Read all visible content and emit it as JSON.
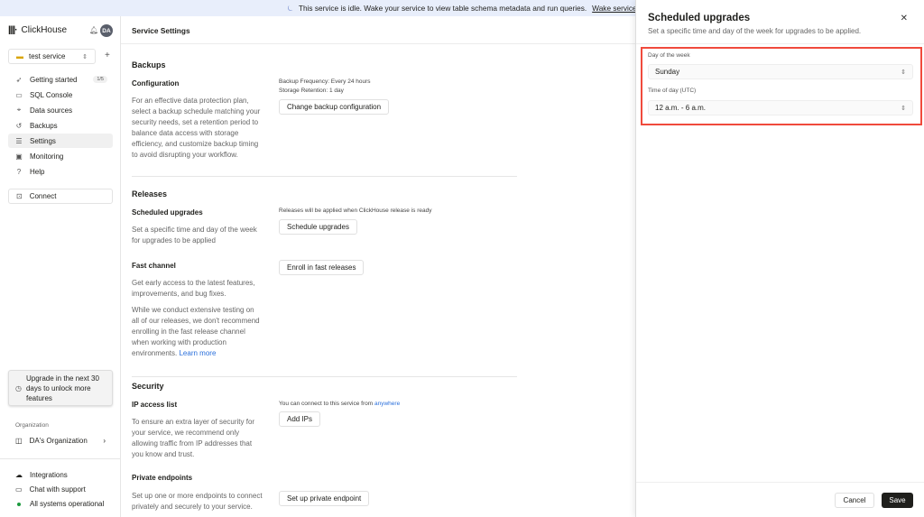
{
  "banner": {
    "text": "This service is idle. Wake your service to view table schema metadata and run queries.",
    "link": "Wake service"
  },
  "sidebar": {
    "brand": "ClickHouse",
    "avatar": "DA",
    "service": "test service",
    "items": [
      {
        "label": "Getting started",
        "icon": "rocket-icon",
        "badge": "1/5"
      },
      {
        "label": "SQL Console",
        "icon": "console-icon"
      },
      {
        "label": "Data sources",
        "icon": "data-sources-icon"
      },
      {
        "label": "Backups",
        "icon": "backup-icon"
      },
      {
        "label": "Settings",
        "icon": "settings-icon",
        "active": true
      },
      {
        "label": "Monitoring",
        "icon": "monitoring-icon"
      },
      {
        "label": "Help",
        "icon": "help-icon"
      }
    ],
    "connect": "Connect",
    "upgrade": "Upgrade in the next 30 days to unlock more features",
    "org_label": "Organization",
    "org": "DA's Organization",
    "footer": [
      "Integrations",
      "Chat with support",
      "All systems operational"
    ],
    "status_color": "#1c9a3f"
  },
  "main": {
    "title": "Service Settings",
    "backups": {
      "heading": "Backups",
      "sub": "Configuration",
      "desc": "For an effective data protection plan, select a backup schedule matching your security needs, set a retention period to balance data access with storage efficiency, and customize backup timing to avoid disrupting your workflow.",
      "freq": "Backup Frequency: Every 24 hours",
      "retention": "Storage Retention: 1 day",
      "button": "Change backup configuration"
    },
    "releases": {
      "heading": "Releases",
      "sched_title": "Scheduled upgrades",
      "sched_desc": "Set a specific time and day of the week for upgrades to be applied",
      "sched_note": "Releases will be applied when ClickHouse release is ready",
      "sched_button": "Schedule upgrades",
      "fast_title": "Fast channel",
      "fast_desc": "Get early access to the latest features, improvements, and bug fixes.",
      "fast_desc2": "While we conduct extensive testing on all of our releases, we don't recommend enrolling in the fast release channel when working with production environments.",
      "learn_more": "Learn more",
      "fast_button": "Enroll in fast releases"
    },
    "security": {
      "heading": "Security",
      "ip_title": "IP access list",
      "ip_desc": "To ensure an extra layer of security for your service, we recommend only allowing traffic from IP addresses that you know and trust.",
      "ip_note": "You can connect to this service from",
      "ip_link": "anywhere",
      "ip_button": "Add IPs",
      "pe_title": "Private endpoints",
      "pe_desc": "Set up one or more endpoints to connect privately and securely to your service.",
      "pe_button": "Set up private endpoint"
    }
  },
  "panel": {
    "title": "Scheduled upgrades",
    "subtitle": "Set a specific time and day of the week for upgrades to be applied.",
    "day_label": "Day of the week",
    "day_value": "Sunday",
    "time_label": "Time of day (UTC)",
    "time_value": "12 a.m. - 6 a.m.",
    "cancel": "Cancel",
    "save": "Save",
    "highlight_color": "#f04a3c"
  }
}
